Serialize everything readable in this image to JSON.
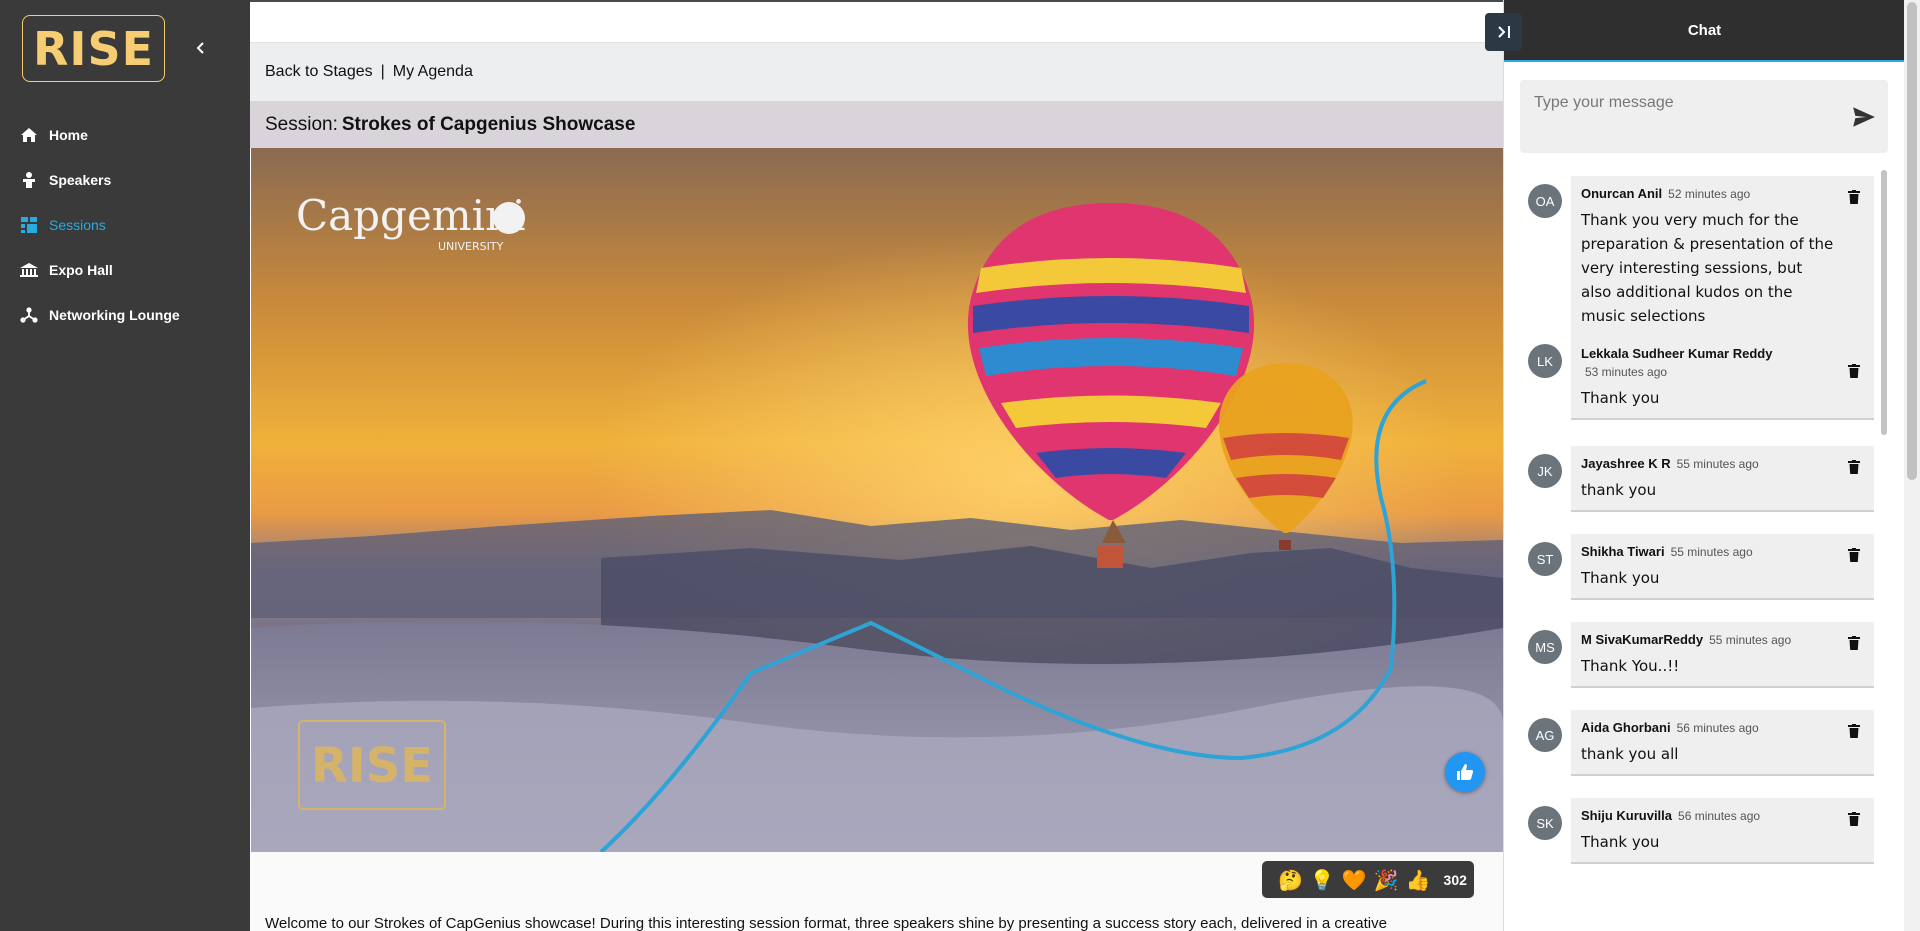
{
  "sidebar": {
    "logo_text": "RISE",
    "items": [
      {
        "label": "Home",
        "icon": "home-icon"
      },
      {
        "label": "Speakers",
        "icon": "podium-icon"
      },
      {
        "label": "Sessions",
        "icon": "sessions-icon",
        "active": true
      },
      {
        "label": "Expo Hall",
        "icon": "building-icon"
      },
      {
        "label": "Networking Lounge",
        "icon": "network-icon"
      }
    ]
  },
  "breadcrumbs": {
    "back": "Back to Stages",
    "separator": "|",
    "agenda": "My Agenda"
  },
  "session": {
    "prefix": "Session:",
    "title": "Strokes of Capgenius Showcase"
  },
  "stage": {
    "brand": "Capgemini",
    "brand_sub": "UNIVERSITY",
    "badge": "RISE"
  },
  "reactions": {
    "items": [
      "🤔",
      "💡",
      "🧡",
      "🎉",
      "👍"
    ],
    "count": "302"
  },
  "description": "Welcome to our Strokes of CapGenius showcase! During this interesting session format, three speakers shine by presenting a success story each, delivered in a creative",
  "chat": {
    "title": "Chat",
    "placeholder": "Type your message",
    "messages": [
      {
        "initials": "OA",
        "name": "Onurcan Anil",
        "time": "52 minutes ago",
        "text": "Thank you very much for the preparation & presentation of the very interesting sessions, but also additional kudos on the music selections"
      },
      {
        "initials": "LK",
        "name": "Lekkala Sudheer Kumar Reddy",
        "time": "53 minutes ago",
        "text": "Thank you"
      },
      {
        "initials": "JK",
        "name": "Jayashree K R",
        "time": "55 minutes ago",
        "text": "thank you"
      },
      {
        "initials": "ST",
        "name": "Shikha Tiwari",
        "time": "55 minutes ago",
        "text": "Thank you"
      },
      {
        "initials": "MS",
        "name": "M SivaKumarReddy",
        "time": "55 minutes ago",
        "text": "Thank You..!!"
      },
      {
        "initials": "AG",
        "name": "Aida Ghorbani",
        "time": "56 minutes ago",
        "text": "thank you all"
      },
      {
        "initials": "SK",
        "name": "Shiju Kuruvilla",
        "time": "56 minutes ago",
        "text": "Thank you"
      }
    ]
  },
  "colors": {
    "accent": "#29abe2",
    "gold": "#f6cd72",
    "sidebar": "#3a3a3a",
    "like": "#2196f3"
  }
}
